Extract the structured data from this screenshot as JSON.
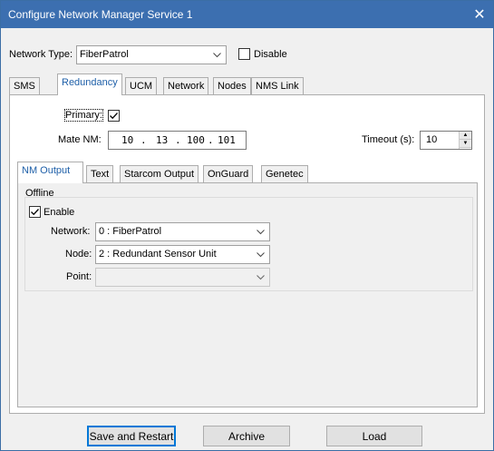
{
  "window": {
    "title": "Configure Network Manager Service 1",
    "close_glyph": "✕",
    "titlebar_color": "#3c6fb0"
  },
  "network_type": {
    "label": "Network Type:",
    "value": "FiberPatrol",
    "disable_label": "Disable",
    "disable_checked": false
  },
  "main_tabs": [
    {
      "label": "SMS",
      "active": false
    },
    {
      "label": "Redundancy",
      "active": true
    },
    {
      "label": "UCM",
      "active": false
    },
    {
      "label": "Network",
      "active": false
    },
    {
      "label": "Nodes",
      "active": false
    },
    {
      "label": "NMS Link",
      "active": false
    }
  ],
  "redundancy": {
    "primary_label": "Primary:",
    "primary_checked": true,
    "mate_nm_label": "Mate NM:",
    "mate_nm_octets": [
      "10",
      "13",
      "100",
      "101"
    ],
    "ip_separator": ".",
    "timeout_label": "Timeout (s):",
    "timeout_value": "10"
  },
  "sub_tabs": [
    {
      "label": "NM Output",
      "active": true
    },
    {
      "label": "Text",
      "active": false
    },
    {
      "label": "Starcom Output",
      "active": false
    },
    {
      "label": "OnGuard",
      "active": false
    },
    {
      "label": "Genetec",
      "active": false
    }
  ],
  "offline": {
    "group_label": "Offline",
    "enable_label": "Enable",
    "enable_checked": true,
    "network_label": "Network:",
    "network_value": "0 : FiberPatrol",
    "node_label": "Node:",
    "node_value": "2 : Redundant Sensor Unit",
    "point_label": "Point:",
    "point_value": ""
  },
  "buttons": {
    "save_restart": "Save and Restart",
    "archive": "Archive",
    "load": "Load"
  },
  "accent_color": "#1e5fa8"
}
